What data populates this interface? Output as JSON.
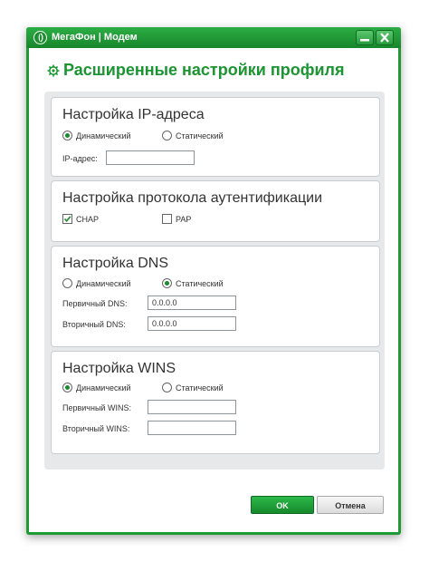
{
  "window": {
    "title": "МегаФон | Модем"
  },
  "page": {
    "title": "Расширенные настройки профиля"
  },
  "ip_section": {
    "title": "Настройка IP-адреса",
    "dynamic_label": "Динамический",
    "static_label": "Статический",
    "selected": "dynamic",
    "ip_label": "IP-адрес:",
    "ip_value": ""
  },
  "auth_section": {
    "title": "Настройка протокола аутентификации",
    "chap_label": "CHAP",
    "chap_checked": true,
    "pap_label": "PAP",
    "pap_checked": false
  },
  "dns_section": {
    "title": "Настройка DNS",
    "dynamic_label": "Динамический",
    "static_label": "Статический",
    "selected": "static",
    "primary_label": "Первичный DNS:",
    "primary_value": "0.0.0.0",
    "secondary_label": "Вторичный DNS:",
    "secondary_value": "0.0.0.0"
  },
  "wins_section": {
    "title": "Настройка WINS",
    "dynamic_label": "Динамический",
    "static_label": "Статический",
    "selected": "dynamic",
    "primary_label": "Первичный WINS:",
    "primary_value": "",
    "secondary_label": "Вторичный WINS:",
    "secondary_value": ""
  },
  "buttons": {
    "ok_label": "OK",
    "cancel_label": "Отмена"
  },
  "colors": {
    "brand_green": "#1a9531",
    "frame_green": "#1f9a34"
  }
}
